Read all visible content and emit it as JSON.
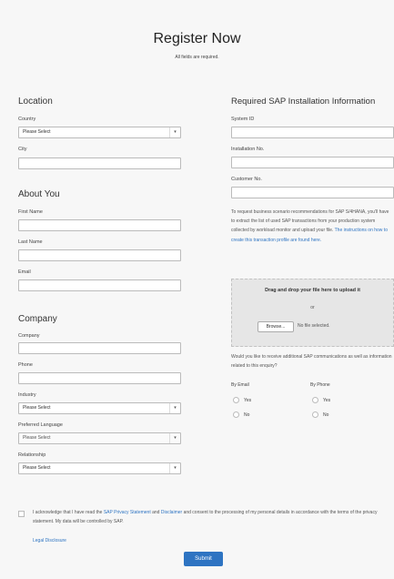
{
  "header": {
    "title": "Register Now",
    "subtitle": "All fields are required."
  },
  "location": {
    "heading": "Location",
    "country_label": "Country",
    "country_value": "Please Select",
    "city_label": "City"
  },
  "about": {
    "heading": "About You",
    "first_name_label": "First Name",
    "last_name_label": "Last Name",
    "email_label": "Email"
  },
  "company": {
    "heading": "Company",
    "company_label": "Company",
    "phone_label": "Phone",
    "industry_label": "Industry",
    "industry_value": "Please Select",
    "language_label": "Preferred Language",
    "language_value": "Please Select",
    "relationship_label": "Relationship",
    "relationship_value": "Please Select"
  },
  "sap": {
    "heading": "Required SAP Installation Information",
    "system_id_label": "System ID",
    "installation_no_label": "Installation No.",
    "customer_no_label": "Customer No.",
    "info_text": "To request business scenario recommendations for SAP S/4HANA, you'll have to extract the list of used SAP transactions from your production system collected by workload monitor and upload your file.",
    "info_link": "The instructions on how to create this transaction profile are found here."
  },
  "upload": {
    "title": "Drag and drop your file here to upload it",
    "or": "or",
    "browse": "Browse...",
    "no_file": "No file selected."
  },
  "communications": {
    "question": "Would you like to receive additional SAP communications as well as information related to this enquiry?",
    "by_email": "By Email",
    "by_phone": "By Phone",
    "yes": "Yes",
    "no": "No"
  },
  "consent": {
    "text_before": "I acknowledge that I have read the ",
    "privacy_link": "SAP Privacy Statement",
    "and": " and ",
    "disclaimer_link": "Disclaimer",
    "text_after": " and consent to the processing of my personal details in accordance with the terms of the privacy statement. My data will be controlled by SAP.",
    "legal_link": "Legal Disclosure"
  },
  "submit": "Submit",
  "icons": {
    "select_arrow": "chevron-down-icon"
  },
  "colors": {
    "accent": "#2e74c2",
    "background": "#f7f7f7"
  }
}
